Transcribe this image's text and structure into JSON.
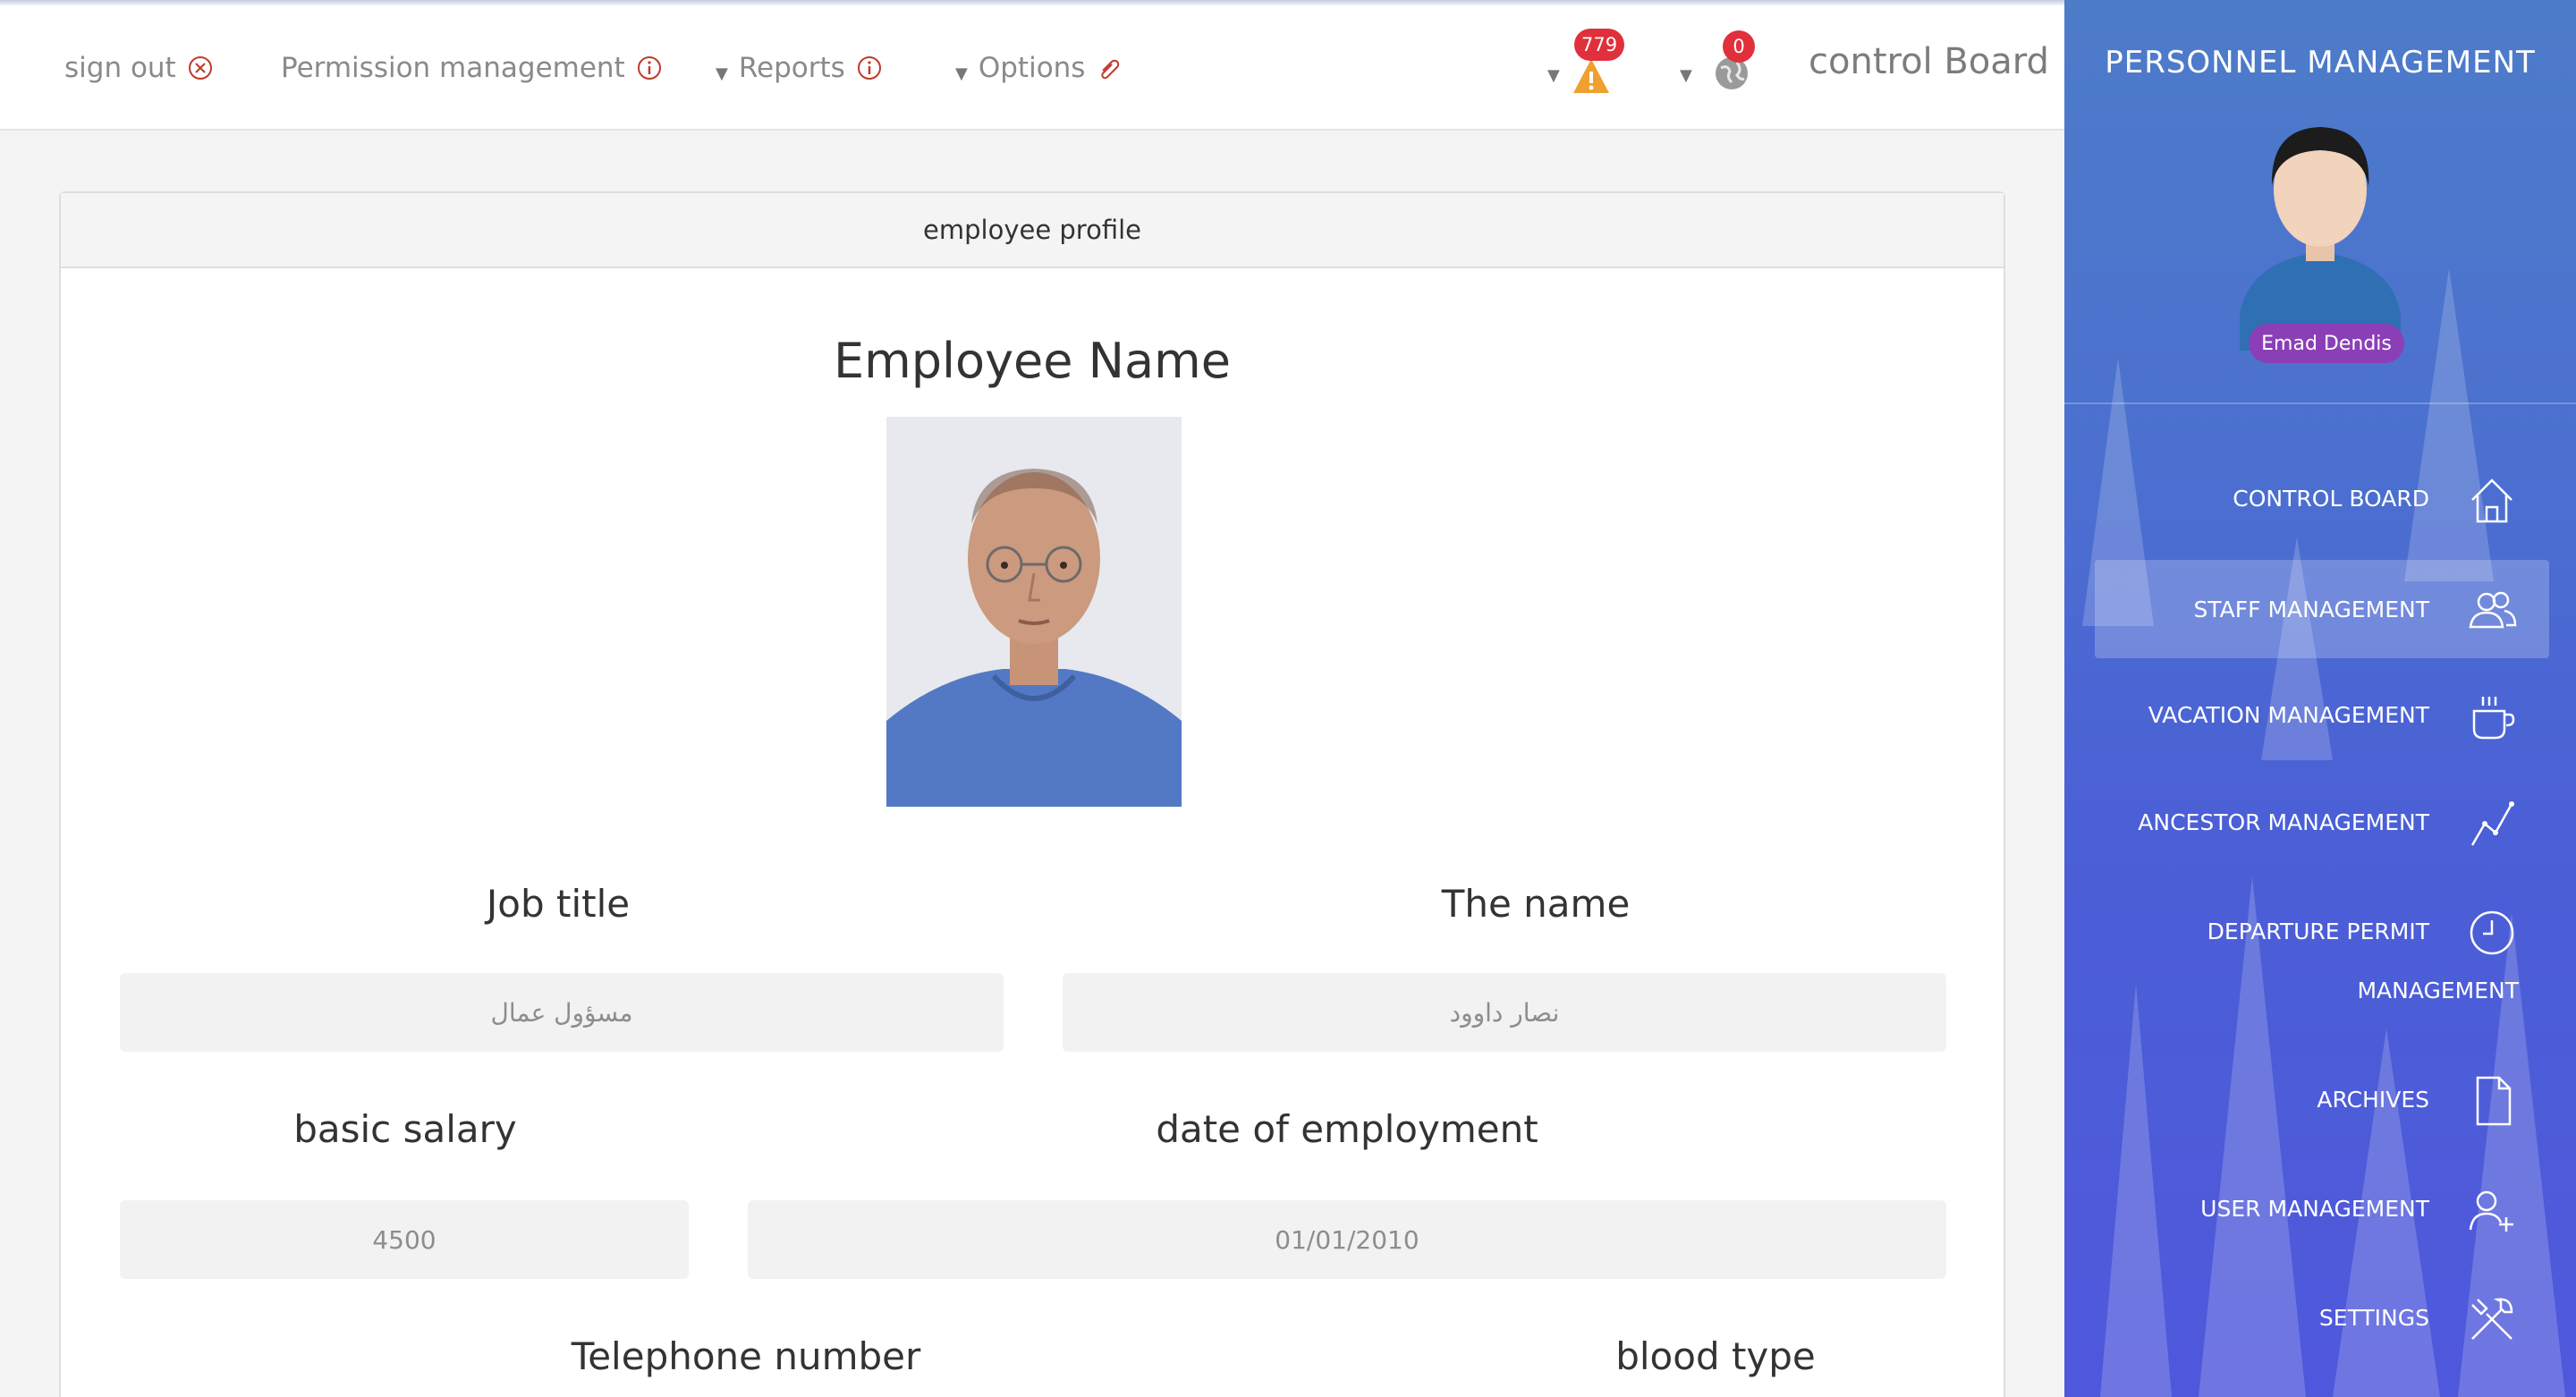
{
  "topbar": {
    "sign_out": "sign out",
    "permission": "Permission management",
    "reports": "Reports",
    "options": "Options",
    "alerts_count": "779",
    "messages_count": "0",
    "board_title": "control Board"
  },
  "profile": {
    "card_title": "employee profile",
    "employee_name_heading": "Employee Name",
    "fields": {
      "job_title_label": "Job title",
      "job_title_value": "مسؤول عمال",
      "name_label": "The name",
      "name_value": "نصار داوود",
      "salary_label": "basic salary",
      "salary_value": "4500",
      "employment_date_label": "date of employment",
      "employment_date_value": "01/01/2010",
      "telephone_label": "Telephone number",
      "blood_type_label": "blood type"
    }
  },
  "sidebar": {
    "title": "PERSONNEL MANAGEMENT",
    "user_name": "Emad Dendis",
    "items": [
      {
        "label": "CONTROL BOARD",
        "icon": "home-icon"
      },
      {
        "label": "STAFF MANAGEMENT",
        "icon": "users-icon"
      },
      {
        "label": "VACATION MANAGEMENT",
        "icon": "cup-icon"
      },
      {
        "label": "ANCESTOR MANAGEMENT",
        "icon": "chart-line-icon"
      },
      {
        "label": "DEPARTURE PERMIT",
        "label2": "MANAGEMENT",
        "icon": "clock-icon"
      },
      {
        "label": "ARCHIVES",
        "icon": "document-icon"
      },
      {
        "label": "USER MANAGEMENT",
        "icon": "user-add-icon"
      },
      {
        "label": "SETTINGS",
        "icon": "tools-icon"
      }
    ],
    "active_index": 1
  },
  "colors": {
    "sidebar_top": "#4d7cc9",
    "sidebar_bottom": "#4f58dc",
    "badge": "#e0303b",
    "user_tag": "#8b3fb6"
  }
}
